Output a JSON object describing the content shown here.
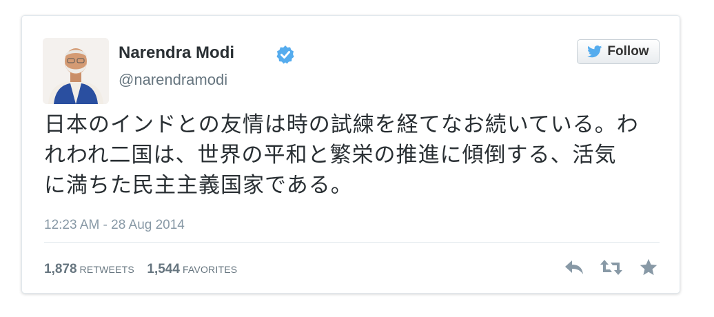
{
  "user": {
    "name": "Narendra Modi",
    "handle": "@narendramodi",
    "verified": true
  },
  "follow_button": {
    "label": "Follow",
    "icon": "twitter-bird-icon"
  },
  "tweet": {
    "lines": [
      "日本のインドとの友情は時の試練を経てなお続いている。わ",
      "れわれ二国は、世界の平和と繁栄の推進に傾倒する、活気",
      "に満ちた民主主義国家である。"
    ],
    "timestamp": "12:23 AM - 28 Aug 2014"
  },
  "stats": {
    "retweets_count": "1,878",
    "retweets_label": "RETWEETS",
    "favorites_count": "1,544",
    "favorites_label": "FAVORITES"
  },
  "actions": [
    {
      "name": "reply",
      "icon": "reply-icon"
    },
    {
      "name": "retweet",
      "icon": "retweet-icon"
    },
    {
      "name": "favorite",
      "icon": "star-icon"
    }
  ],
  "colors": {
    "text": "#292f33",
    "secondary": "#66757f",
    "verified": "#55acee",
    "action_icon": "#8899a6"
  }
}
